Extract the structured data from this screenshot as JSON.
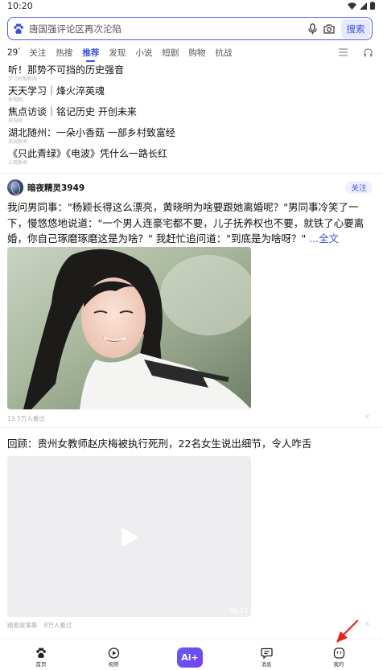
{
  "status_bar": {
    "time": "10:20"
  },
  "search": {
    "placeholder": "唐国强评论区再次沦陷",
    "button_label": "搜索"
  },
  "tabs": {
    "temperature": "29",
    "temperature_unit": "°",
    "items": [
      "关注",
      "热搜",
      "推荐",
      "发现",
      "小说",
      "短剧",
      "购物",
      "抗战"
    ],
    "active_index": 2
  },
  "hot_list": [
    {
      "title": "听！那势不可挡的历史强音",
      "source": "学习时报新闻"
    },
    {
      "title": "天天学习｜烽火淬英魂",
      "source": "央视网"
    },
    {
      "title": "焦点访谈｜铭记历史 开创未来",
      "source": "央视网"
    },
    {
      "title": "湖北随州：一朵小香菇 一部乡村致富经",
      "source": "央视新闻"
    },
    {
      "title": "《只此青绿》《电波》凭什么一路长红",
      "source": "上观新闻"
    }
  ],
  "post": {
    "author": "暗夜精灵3949",
    "follow_label": "关注",
    "text": "我问男同事：\"杨颖长得这么漂亮，黄晓明为啥要跟她离婚呢？\"男同事冷笑了一下，慢悠悠地说道：\"一个男人连豪宅都不要，儿子抚养权也不要，就铁了心要离婚，你自己琢磨琢磨这是为啥？\" 我赶忙追问道：\"到底是为啥呀？\" ",
    "more_label": "...全文",
    "views": "13.5万人看过",
    "close_glyph": "×"
  },
  "video": {
    "title": "回顾：贵州女教师赵庆梅被执行死刑，22名女生说出细节，令人咋舌",
    "duration": "06:13",
    "channel": "踏着故事集",
    "views": "8万人看过",
    "close_glyph": "×"
  },
  "bottom_nav": {
    "home": "首页",
    "video": "视频",
    "ai": "Ai+",
    "messages": "消息",
    "mine": "我的"
  },
  "colors": {
    "accent": "#3c50e0",
    "arrow": "#e8201c"
  }
}
